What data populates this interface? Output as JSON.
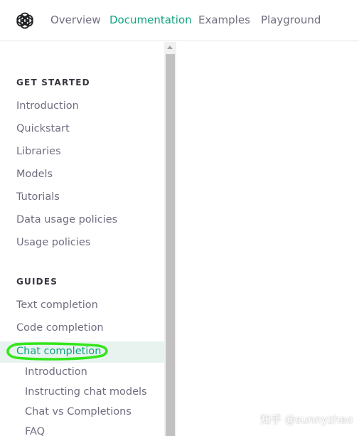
{
  "nav": {
    "items": [
      {
        "label": "Overview"
      },
      {
        "label": "Documentation"
      },
      {
        "label": "Examples"
      },
      {
        "label": "Playground"
      }
    ],
    "active_index": 1
  },
  "sidebar": {
    "sections": [
      {
        "title": "GET STARTED",
        "items": [
          "Introduction",
          "Quickstart",
          "Libraries",
          "Models",
          "Tutorials",
          "Data usage policies",
          "Usage policies"
        ]
      },
      {
        "title": "GUIDES",
        "items": [
          "Text completion",
          "Code completion",
          "Chat completion"
        ],
        "active_item": "Chat completion",
        "subitems": [
          "Introduction",
          "Instructing chat models",
          "Chat vs Completions",
          "FAQ"
        ]
      }
    ]
  },
  "watermark": "知乎 @sunnyzhao",
  "colors": {
    "accent": "#10a37f",
    "text_muted": "#6e6e80",
    "text_dark": "#353740",
    "active_bg": "#e8f3f0",
    "annotation": "#33e61a"
  }
}
